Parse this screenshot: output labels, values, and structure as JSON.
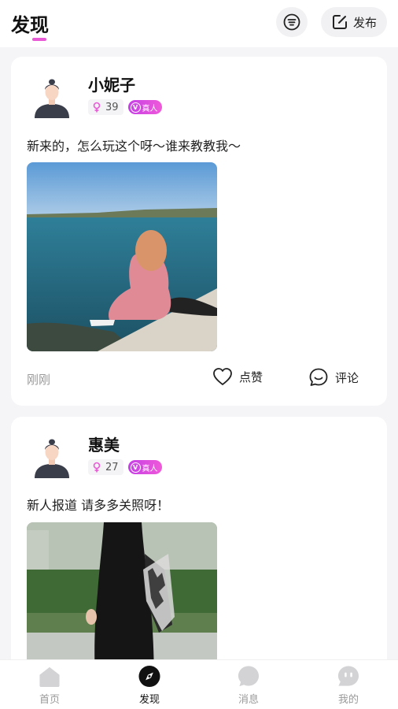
{
  "header": {
    "title": "发现",
    "filter_icon": "filter-lines-icon",
    "publish_label": "发布",
    "publish_icon": "edit-icon",
    "accent_color": "#e85ad6"
  },
  "posts": [
    {
      "name": "小妮子",
      "gender_icon": "female-icon",
      "age": "39",
      "verified_label": "真人",
      "verified_mark": "V",
      "text": "新来的，怎么玩这个呀～谁来教教我～",
      "photo": "woman-in-pink-dress-sitting-by-sea",
      "time": "刚刚",
      "like_label": "点赞",
      "comment_label": "评论"
    },
    {
      "name": "惠美",
      "gender_icon": "female-icon",
      "age": "27",
      "verified_label": "真人",
      "verified_mark": "V",
      "text": "新人报道 请多多关照呀！",
      "photo": "woman-in-black-dress-holding-plaid-shirt"
    }
  ],
  "tabbar": {
    "items": [
      {
        "label": "首页",
        "icon": "home-icon"
      },
      {
        "label": "发现",
        "icon": "compass-icon",
        "active": true
      },
      {
        "label": "消息",
        "icon": "message-icon"
      },
      {
        "label": "我的",
        "icon": "profile-icon"
      }
    ]
  }
}
